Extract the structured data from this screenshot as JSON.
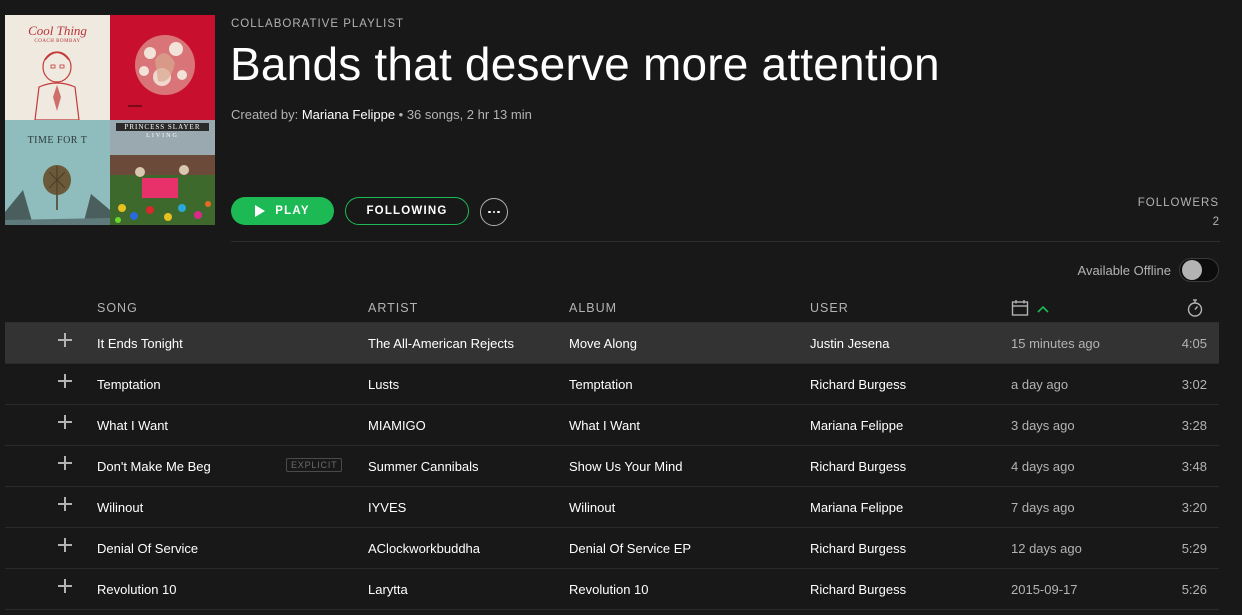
{
  "cover": {
    "tiles": [
      {
        "name": "album-art-cool-thing",
        "label": "Cool Thing",
        "sublabel": "COACH BOMBAY",
        "bg": "#efe9df"
      },
      {
        "name": "album-art-red-puzzle",
        "bg": "#c8102e"
      },
      {
        "name": "album-art-time-for-t",
        "label": "TIME FOR T",
        "bg": "#8fbcbc"
      },
      {
        "name": "album-art-princess-slayer",
        "label": "PRINCESS SLAYER",
        "sublabel": "LIVING",
        "bg": "#3c5a2a"
      }
    ]
  },
  "header": {
    "kicker": "COLLABORATIVE PLAYLIST",
    "title": "Bands that deserve more attention",
    "created_by_label": "Created by:",
    "creator": "Mariana Felippe",
    "stats": " • 36 songs, 2 hr 13 min"
  },
  "actions": {
    "play_label": "PLAY",
    "following_label": "FOLLOWING",
    "more_icon": "more-dots-icon"
  },
  "followers": {
    "label": "FOLLOWERS",
    "count": "2"
  },
  "offline": {
    "label": "Available Offline",
    "enabled": false
  },
  "table": {
    "columns": {
      "song": "SONG",
      "artist": "ARTIST",
      "album": "ALBUM",
      "user": "USER",
      "date_icon": "calendar-icon",
      "sort_icon": "chevron-up-icon",
      "duration_icon": "stopwatch-icon"
    },
    "rows": [
      {
        "song": "It Ends Tonight",
        "explicit": "",
        "artist": "The All-American Rejects",
        "album": "Move Along",
        "user": "Justin Jesena",
        "added": "15 minutes ago",
        "duration": "4:05",
        "selected": true
      },
      {
        "song": "Temptation",
        "explicit": "",
        "artist": "Lusts",
        "album": "Temptation",
        "user": "Richard Burgess",
        "added": "a day ago",
        "duration": "3:02",
        "selected": false
      },
      {
        "song": "What I Want",
        "explicit": "",
        "artist": "MIAMIGO",
        "album": "What I Want",
        "user": "Mariana Felippe",
        "added": "3 days ago",
        "duration": "3:28",
        "selected": false
      },
      {
        "song": "Don't Make Me Beg",
        "explicit": "EXPLICIT",
        "artist": "Summer Cannibals",
        "album": "Show Us Your Mind",
        "user": "Richard Burgess",
        "added": "4 days ago",
        "duration": "3:48",
        "selected": false
      },
      {
        "song": "Wilinout",
        "explicit": "",
        "artist": "IYVES",
        "album": "Wilinout",
        "user": "Mariana Felippe",
        "added": "7 days ago",
        "duration": "3:20",
        "selected": false
      },
      {
        "song": "Denial Of Service",
        "explicit": "",
        "artist": "AClockworkbuddha",
        "album": "Denial Of Service EP",
        "user": "Richard Burgess",
        "added": "12 days ago",
        "duration": "5:29",
        "selected": false
      },
      {
        "song": "Revolution 10",
        "explicit": "",
        "artist": "Larytta",
        "album": "Revolution 10",
        "user": "Richard Burgess",
        "added": "2015-09-17",
        "duration": "5:26",
        "selected": false
      }
    ]
  },
  "colors": {
    "background": "#181818",
    "accent": "#1db954",
    "text_secondary": "#b3b3b3",
    "row_selected": "#333333"
  }
}
